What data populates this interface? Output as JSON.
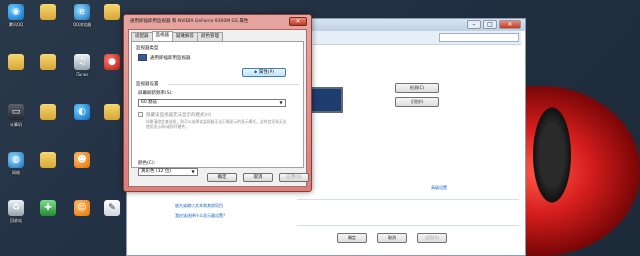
{
  "colors": {
    "dialog_frame": "#d97f78",
    "link": "#0b5fc5",
    "car_red": "#d71e1e"
  },
  "desktop": {
    "icons": [
      {
        "label": "腾讯QQ",
        "icon": "qq-icon"
      },
      {
        "label": "",
        "icon": "folder-icon"
      },
      {
        "label": "QQ浏览器",
        "icon": "browser-icon"
      },
      {
        "label": "",
        "icon": "folder-icon"
      },
      {
        "label": "",
        "icon": "folder-icon"
      },
      {
        "label": "",
        "icon": "app-icon"
      },
      {
        "label": "",
        "icon": "folder-icon"
      },
      {
        "label": "",
        "icon": "folder-icon"
      },
      {
        "label": "iTunes",
        "icon": "itunes-icon"
      },
      {
        "label": "计算机",
        "icon": "computer-icon"
      },
      {
        "label": "",
        "icon": "folder-icon"
      },
      {
        "label": "",
        "icon": "app-icon"
      },
      {
        "label": "网络",
        "icon": "network-icon"
      },
      {
        "label": "",
        "icon": "folder-icon"
      },
      {
        "label": "",
        "icon": "app-icon"
      },
      {
        "label": "回收站",
        "icon": "recycle-bin-icon"
      },
      {
        "label": "",
        "icon": "app-icon"
      },
      {
        "label": "",
        "icon": "app-icon"
      },
      {
        "label": "",
        "icon": "app-icon"
      }
    ]
  },
  "dialog": {
    "title": "通用即插即用监视器 和 NVIDIA GeForce 9300M GS 属性",
    "close_glyph": "✕",
    "tabs": [
      {
        "label": "适配器"
      },
      {
        "label": "监视器"
      },
      {
        "label": "疑难解答"
      },
      {
        "label": "颜色管理"
      }
    ],
    "monitor_type_label": "监视器类型",
    "monitor_name": "通用即插即用监视器",
    "properties_button": "属性(P)",
    "monitor_settings_label": "监视器设置",
    "refresh_rate_label": "屏幕刷新频率(S):",
    "refresh_rate_value": "60 赫兹",
    "hide_modes_label": "隐藏该监视器无法显示的模式(H)",
    "hide_modes_desc": "如果清除此复选框，则可以选择该监视器无法正确显示的显示模式。这样会导致无法使用显示和/或损坏硬件。",
    "colors_label": "颜色(C):",
    "colors_value": "真彩色 (32 位)",
    "ok_button": "确定",
    "cancel_button": "取消",
    "apply_button": "应用(A)"
  },
  "back_window": {
    "detect_button": "检测(C)",
    "identify_button": "识别(I)",
    "advanced_link": "高级设置",
    "link_text_size": "放大或缩小文本和其他项目",
    "link_resolution": "我应该选择什么显示器设置?",
    "ok_button": "确定",
    "cancel_button": "取消",
    "apply_button": "应用(A)"
  }
}
